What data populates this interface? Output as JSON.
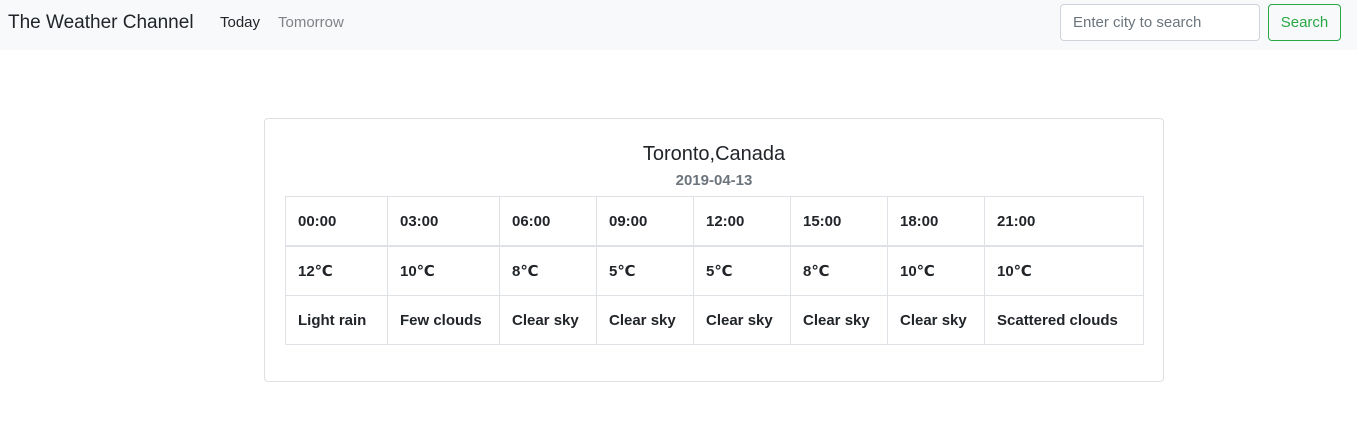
{
  "navbar": {
    "brand": "The Weather Channel",
    "links": [
      {
        "label": "Today"
      },
      {
        "label": "Tomorrow"
      }
    ],
    "search": {
      "placeholder": "Enter city to search",
      "value": "",
      "button_label": "Search"
    },
    "colors": {
      "background": "#f8f9fa",
      "search_button": "#28a745"
    }
  },
  "forecast": {
    "city": "Toronto,Canada",
    "date": "2019-04-13",
    "times": [
      "00:00",
      "03:00",
      "06:00",
      "09:00",
      "12:00",
      "15:00",
      "18:00",
      "21:00"
    ],
    "temperatures": [
      "12℃",
      "10℃",
      "8℃",
      "5℃",
      "5℃",
      "8℃",
      "10℃",
      "10℃"
    ],
    "conditions": [
      "Light rain",
      "Few clouds",
      "Clear sky",
      "Clear sky",
      "Clear sky",
      "Clear sky",
      "Clear sky",
      "Scattered clouds"
    ]
  }
}
